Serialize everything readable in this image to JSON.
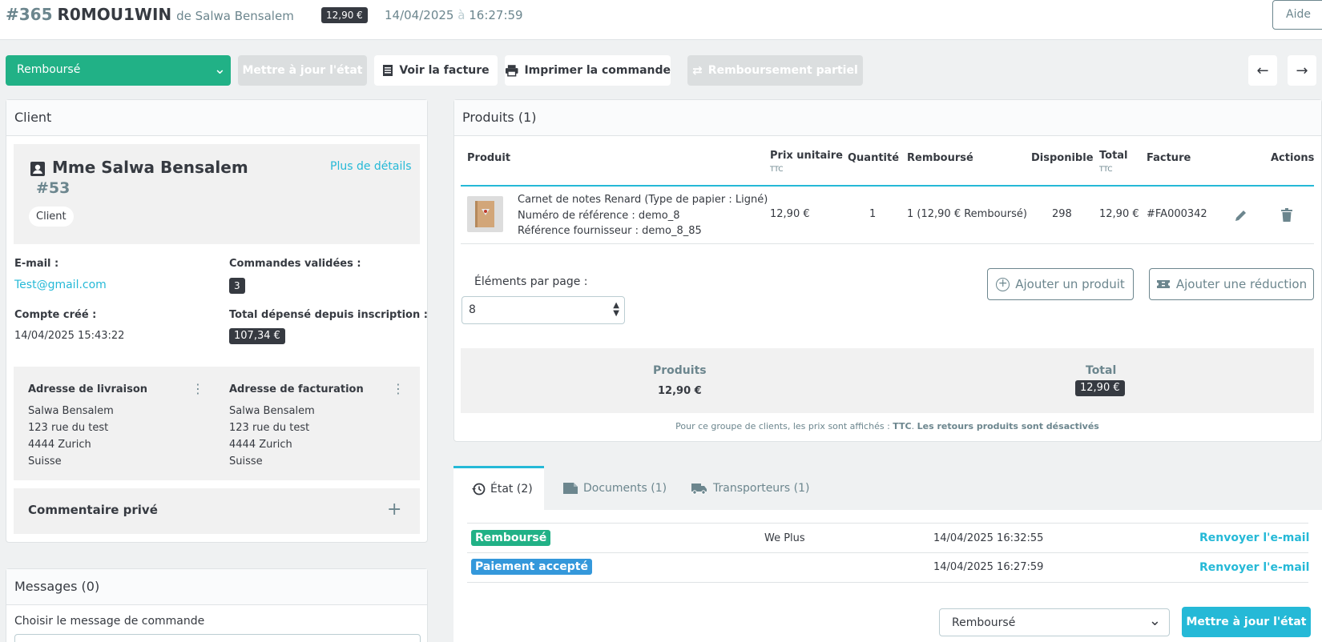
{
  "header": {
    "order_number": "#365",
    "order_reference": "R0MOU1WIN",
    "by_customer": "de Salwa Bensalem",
    "total_badge": "12,90 €",
    "date": "14/04/2025",
    "date_sep": "à",
    "time": "16:27:59",
    "help_label": "Aide"
  },
  "toolbar": {
    "status_value": "Remboursé",
    "update_state_label": "Mettre à jour l'état",
    "view_invoice_label": "Voir la facture",
    "print_order_label": "Imprimer la commande",
    "partial_refund_label": "Remboursement partiel"
  },
  "client": {
    "title": "Client",
    "name": "Mme Salwa Bensalem",
    "id": "#53",
    "more_details": "Plus de détails",
    "group": "Client",
    "email_label": "E-mail :",
    "email": "Test@gmail.com",
    "orders_label": "Commandes validées :",
    "orders_count": "3",
    "created_label": "Compte créé :",
    "created": "14/04/2025 15:43:22",
    "spent_label": "Total dépensé depuis inscription :",
    "spent": "107,34 €",
    "shipping": {
      "title": "Adresse de livraison",
      "lines": [
        "Salwa Bensalem",
        "123 rue du test",
        "4444 Zurich",
        "Suisse"
      ]
    },
    "billing": {
      "title": "Adresse de facturation",
      "lines": [
        "Salwa Bensalem",
        "123 rue du test",
        "4444 Zurich",
        "Suisse"
      ]
    },
    "private_comment": "Commentaire privé"
  },
  "messages": {
    "title": "Messages (0)",
    "choose_label": "Choisir le message de commande"
  },
  "products": {
    "title": "Produits (1)",
    "columns": {
      "product": "Produit",
      "unit_price": "Prix unitaire",
      "unit_price_sub": "TTC",
      "quantity": "Quantité",
      "refunded": "Remboursé",
      "available": "Disponible",
      "total": "Total",
      "total_sub": "TTC",
      "invoice": "Facture",
      "actions": "Actions"
    },
    "row": {
      "name": "Carnet de notes Renard (Type de papier : Ligné)",
      "reference": "Numéro de référence : demo_8",
      "supplier_ref": "Référence fournisseur : demo_8_85",
      "unit_price": "12,90 €",
      "quantity": "1",
      "refunded": "1 (12,90 € Remboursé)",
      "available": "298",
      "total": "12,90 €",
      "invoice": "#FA000342"
    },
    "per_page_label": "Éléments par page :",
    "per_page_value": "8",
    "add_product": "Ajouter un produit",
    "add_discount": "Ajouter une réduction",
    "summary": {
      "products_label": "Produits",
      "products_value": "12,90 €",
      "total_label": "Total",
      "total_value": "12,90 €"
    },
    "note_prefix": "Pour ce groupe de clients, les prix sont affichés :",
    "note_ttc": "TTC",
    "note_returns": "Les retours produits sont désactivés"
  },
  "tabs": {
    "state": "État (2)",
    "documents": "Documents (1)",
    "carriers": "Transporteurs (1)"
  },
  "history": [
    {
      "status": "Remboursé",
      "color": "#21b186",
      "employee": "We Plus",
      "date": "14/04/2025 16:32:55",
      "action": "Renvoyer l'e-mail"
    },
    {
      "status": "Paiement accepté",
      "color": "#3498db",
      "employee": "",
      "date": "14/04/2025 16:27:59",
      "action": "Renvoyer l'e-mail"
    }
  ],
  "state_form": {
    "select_value": "Remboursé",
    "submit": "Mettre à jour l'état"
  },
  "colors": {
    "accent": "#25b9d7",
    "success": "#21b186",
    "info": "#3498db",
    "dark": "#363a41"
  }
}
